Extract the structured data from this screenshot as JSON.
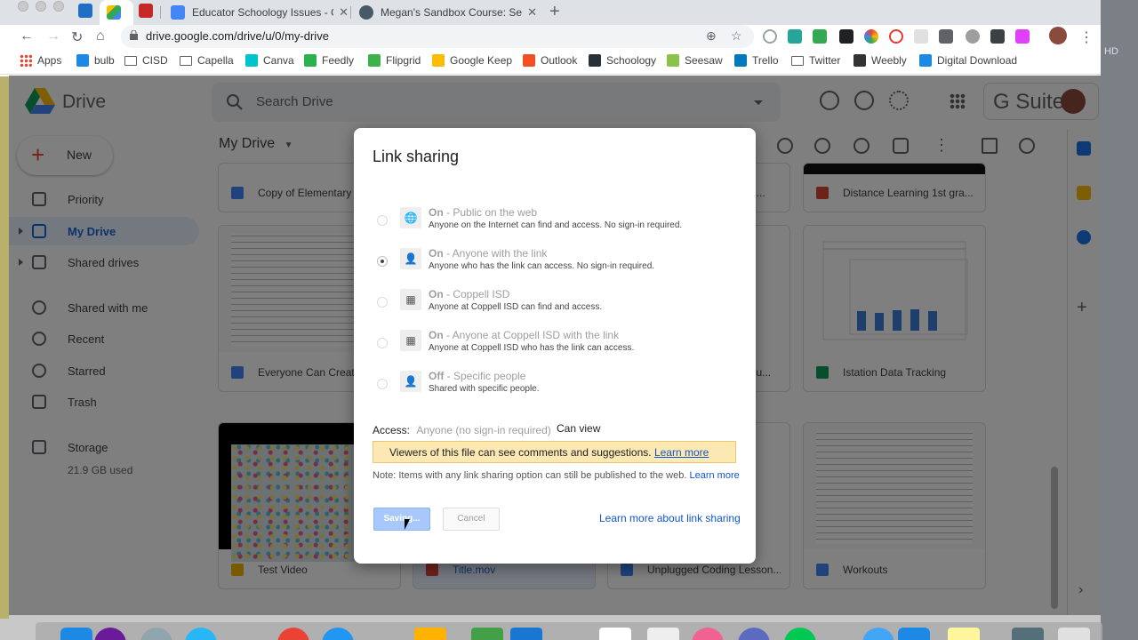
{
  "browser": {
    "tabs": [
      {
        "title": "Educator Schoology Issues - G",
        "color": "#4285f4",
        "active": false
      },
      {
        "title": "Megan's Sandbox Course: Sec",
        "color": "#455a64",
        "active": false
      }
    ],
    "url": "drive.google.com/drive/u/0/my-drive",
    "bookmarks": [
      {
        "label": "Apps",
        "type": "apps"
      },
      {
        "label": "bulb",
        "color": "#1e88e5"
      },
      {
        "label": "CISD",
        "type": "folder"
      },
      {
        "label": "Capella",
        "type": "folder"
      },
      {
        "label": "Canva",
        "color": "#00c4cc"
      },
      {
        "label": "Feedly",
        "color": "#2bb24c"
      },
      {
        "label": "Flipgrid",
        "color": "#3cb34a"
      },
      {
        "label": "Google Keep",
        "color": "#fbbc04"
      },
      {
        "label": "Outlook",
        "color": "#f25022"
      },
      {
        "label": "Schoology",
        "color": "#263238"
      },
      {
        "label": "Seesaw",
        "color": "#8bc34a"
      },
      {
        "label": "Trello",
        "color": "#0079bf"
      },
      {
        "label": "Twitter",
        "type": "folder"
      },
      {
        "label": "Weebly",
        "color": "#333333"
      },
      {
        "label": "Digital Download",
        "color": "#1e88e5"
      }
    ]
  },
  "drive": {
    "app_name": "Drive",
    "search_placeholder": "Search Drive",
    "gsuite_label": "G Suite",
    "new_label": "New",
    "nav": [
      {
        "label": "Priority"
      },
      {
        "label": "My Drive",
        "active": true
      },
      {
        "label": "Shared drives"
      },
      {
        "label": "Shared with me"
      },
      {
        "label": "Recent"
      },
      {
        "label": "Starred"
      },
      {
        "label": "Trash"
      },
      {
        "label": "Storage"
      }
    ],
    "storage_used": "21.9 GB used",
    "location_title": "My Drive",
    "files": [
      {
        "name": "Copy of Elementary",
        "icon_color": "#4285f4"
      },
      {
        "name": "Distance Learning 1st gra...",
        "icon_color": "#db4437"
      },
      {
        "name": "Everyone Can Create",
        "icon_color": "#4285f4"
      },
      {
        "name": "Istation Data Tracking",
        "icon_color": "#0f9d58"
      },
      {
        "name": "Test Video",
        "icon_color": "#f4b400"
      },
      {
        "name": "Title.mov",
        "icon_color": "#db4437"
      },
      {
        "name": "Unplugged Coding Lesson...",
        "icon_color": "#4285f4"
      },
      {
        "name": "Workouts",
        "icon_color": "#4285f4"
      }
    ],
    "partial_names": [
      "am...",
      "Visu..."
    ]
  },
  "dialog": {
    "title": "Link sharing",
    "options": [
      {
        "state": "On",
        "label": " - Public on the web",
        "desc": "Anyone on the Internet can find and access. No sign-in required.",
        "icon": "globe-icon",
        "selected": false
      },
      {
        "state": "On",
        "label": " - Anyone with the link",
        "desc": "Anyone who has the link can access. No sign-in required.",
        "icon": "person-link-icon",
        "selected": true
      },
      {
        "state": "On",
        "label": " - Coppell ISD",
        "desc": "Anyone at Coppell ISD can find and access.",
        "icon": "building-icon",
        "selected": false
      },
      {
        "state": "On",
        "label": " - Anyone at Coppell ISD with the link",
        "desc": "Anyone at Coppell ISD who has the link can access.",
        "icon": "building-link-icon",
        "selected": false
      },
      {
        "state": "Off",
        "label": " - Specific people",
        "desc": "Shared with specific people.",
        "icon": "person-icon",
        "selected": false
      }
    ],
    "access_label": "Access:",
    "access_value": "Anyone (no sign-in required)",
    "access_permission": "Can view",
    "banner_text": "Viewers of this file can see comments and suggestions.",
    "banner_link": "Learn more",
    "note_text": "Note: Items with any link sharing option can still be published to the web.",
    "note_link": "Learn more",
    "save_label": "Saving...",
    "cancel_label": "Cancel",
    "learn_more_label": "Learn more about link sharing"
  }
}
